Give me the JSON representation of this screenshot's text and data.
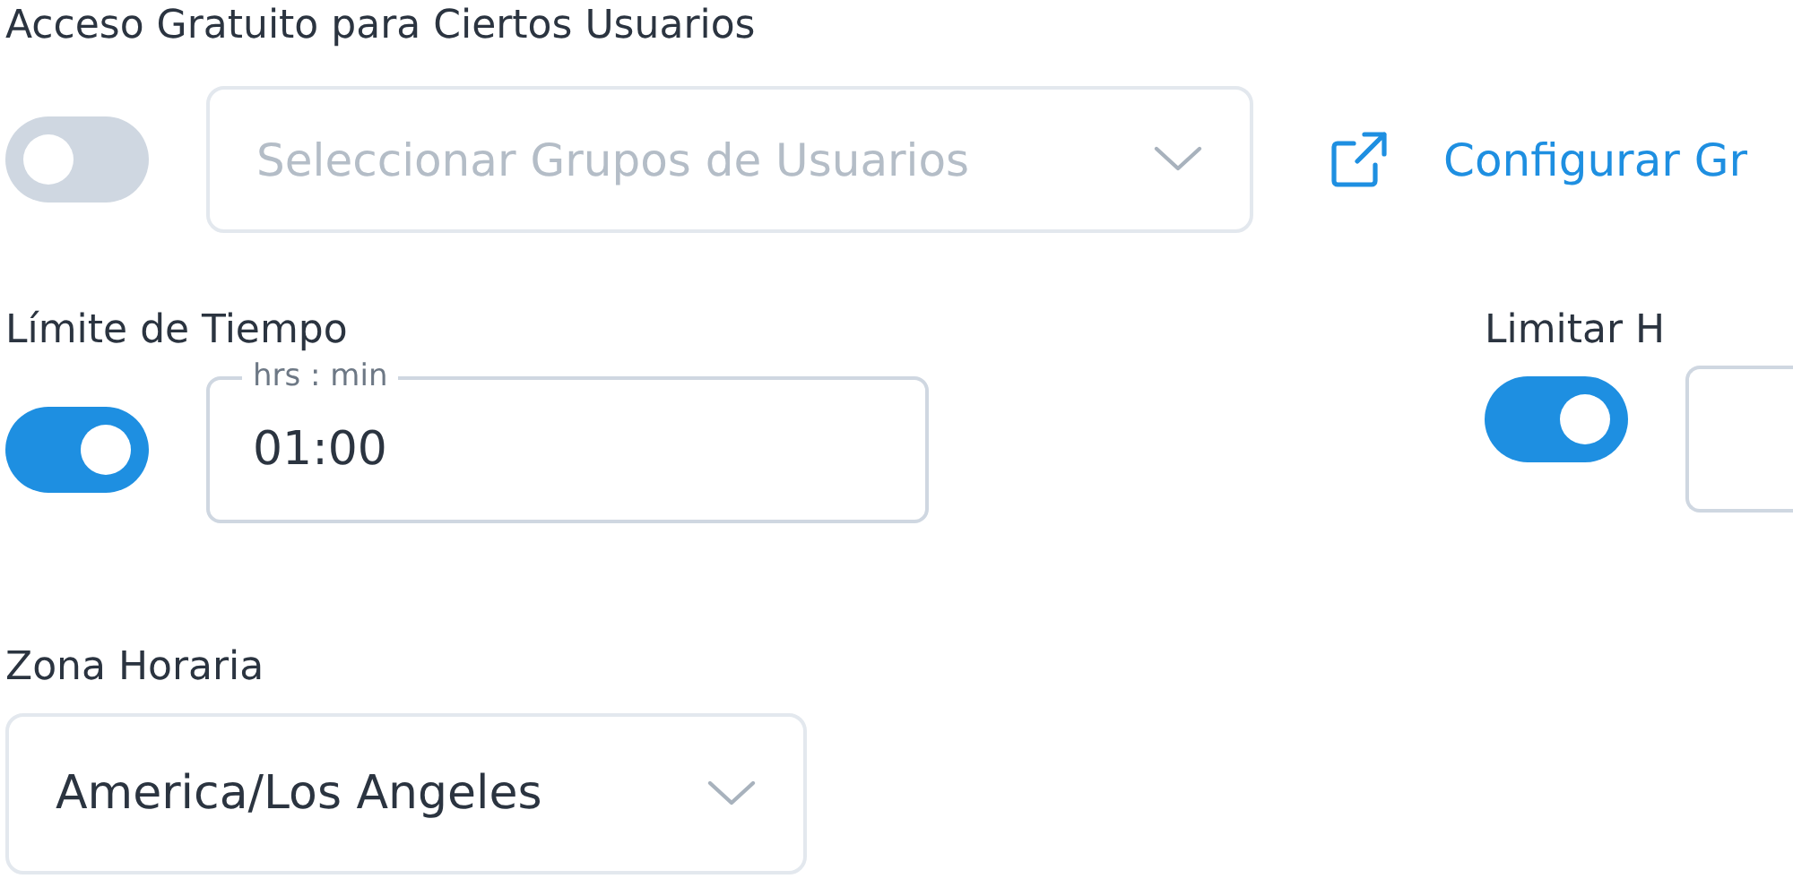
{
  "free_access": {
    "label": "Acceso Gratuito para Ciertos Usuarios",
    "enabled": false,
    "user_groups": {
      "placeholder": "Seleccionar Grupos de Usuarios"
    },
    "configure_link": "Configurar Gr"
  },
  "time_limit": {
    "label": "Límite de Tiempo",
    "enabled": true,
    "field": {
      "label": "hrs : min",
      "value": "01:00"
    }
  },
  "limit_hours": {
    "label": "Limitar H",
    "enabled": true
  },
  "timezone": {
    "label": "Zona Horaria",
    "value": "America/Los Angeles"
  }
}
